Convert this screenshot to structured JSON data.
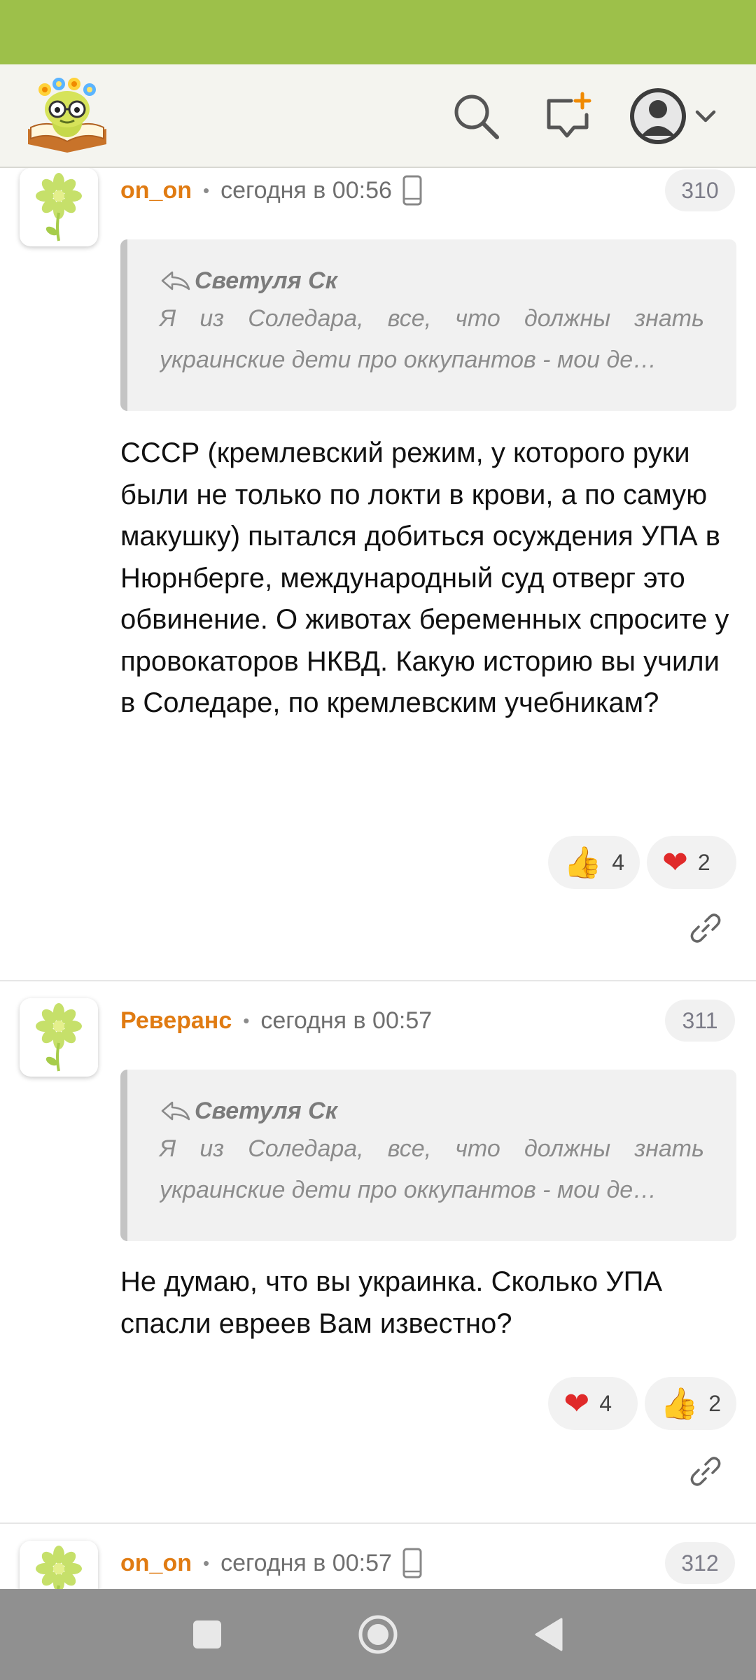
{
  "header": {
    "logo_icon": "bookworm-logo-icon",
    "search_icon": "search-icon",
    "new_post_icon": "new-message-icon",
    "profile_icon": "avatar-icon",
    "dropdown_icon": "chevron-down-icon"
  },
  "colors": {
    "status_bar": "#9dc04a",
    "header_bg": "#f4f4ef",
    "author": "#e07b12",
    "quote_bg": "#f1f1f1",
    "nav_bar": "#909090"
  },
  "comments": [
    {
      "author": "on_on",
      "time": "сегодня в 00:56",
      "device_icon": "mobile-phone-icon",
      "number": "310",
      "quote": {
        "author": "Светуля Ск",
        "text_line1": "Я из Соледара, все, что должны знать",
        "text_line2": "украинские дети про оккупантов - мои де…"
      },
      "text": "СССР (кремлевский режим, у которого руки были не только по локти в крови, а по самую макушку) пытался добиться осуждения УПА в Нюрнберге, международный суд отверг это обвинение. О животах беременных спросите у провокаторов НКВД. Какую историю вы учили в Соледаре, по кремлевским учебникам?",
      "reactions": [
        {
          "emoji": "👍",
          "icon": "thumbs-up-icon",
          "count": "4"
        },
        {
          "emoji": "❤",
          "icon": "heart-icon",
          "count": "2"
        }
      ]
    },
    {
      "author": "Реверанс",
      "time": "сегодня в 00:57",
      "number": "311",
      "quote": {
        "author": "Светуля Ск",
        "text_line1": "Я из Соледара, все, что должны знать",
        "text_line2": "украинские дети про оккупантов - мои де…"
      },
      "text": "Не думаю, что вы украинка. Сколько УПА спасли евреев Вам известно?",
      "reactions": [
        {
          "emoji": "❤",
          "icon": "heart-icon",
          "count": "4"
        },
        {
          "emoji": "👍",
          "icon": "thumbs-up-icon",
          "count": "2"
        }
      ]
    },
    {
      "author": "on_on",
      "time": "сегодня в 00:57",
      "device_icon": "mobile-phone-icon",
      "number": "312"
    }
  ],
  "nav": {
    "recents_icon": "square-recents-icon",
    "home_icon": "circle-home-icon",
    "back_icon": "triangle-back-icon"
  }
}
